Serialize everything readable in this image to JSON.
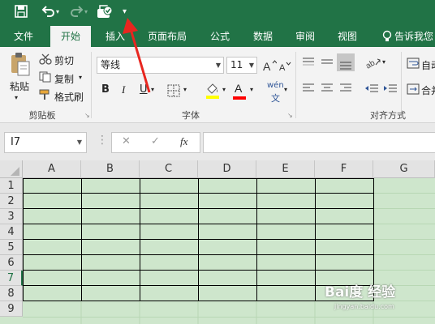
{
  "qat": {
    "save_icon": "save-icon",
    "undo_icon": "undo-icon",
    "redo_icon": "redo-icon",
    "touch_icon": "touch-mode-icon",
    "customize": "▾"
  },
  "tabs": [
    {
      "label": "文件"
    },
    {
      "label": "开始"
    },
    {
      "label": "插入"
    },
    {
      "label": "页面布局"
    },
    {
      "label": "公式"
    },
    {
      "label": "数据"
    },
    {
      "label": "审阅"
    },
    {
      "label": "视图"
    },
    {
      "label": "告诉我您"
    }
  ],
  "ribbon": {
    "clipboard": {
      "paste": "粘贴",
      "cut": "剪切",
      "copy": "复制",
      "format_painter": "格式刷",
      "group": "剪贴板"
    },
    "font": {
      "name": "等线",
      "size": "11",
      "bold": "B",
      "italic": "I",
      "underline": "U",
      "font_color": "A",
      "phonetic": "wén",
      "group": "字体"
    },
    "alignment": {
      "wrap": "自动",
      "merge": "合并",
      "group": "对齐方式"
    }
  },
  "formula_bar": {
    "name_box": "I7",
    "cancel": "✕",
    "enter": "✓",
    "fx": "fx",
    "content": ""
  },
  "grid": {
    "columns": [
      "A",
      "B",
      "C",
      "D",
      "E",
      "F",
      "G"
    ],
    "rows": [
      "1",
      "2",
      "3",
      "4",
      "5",
      "6",
      "7",
      "8",
      "9"
    ],
    "selected_row": "7",
    "fill_color": "#cee6cc"
  },
  "watermark": {
    "text": "Bai度 经验",
    "sub": "jingyan.baidu.com"
  },
  "colors": {
    "brand": "#217346",
    "font_color_bar": "#ff0000",
    "highlight_bar": "#ffff00"
  }
}
